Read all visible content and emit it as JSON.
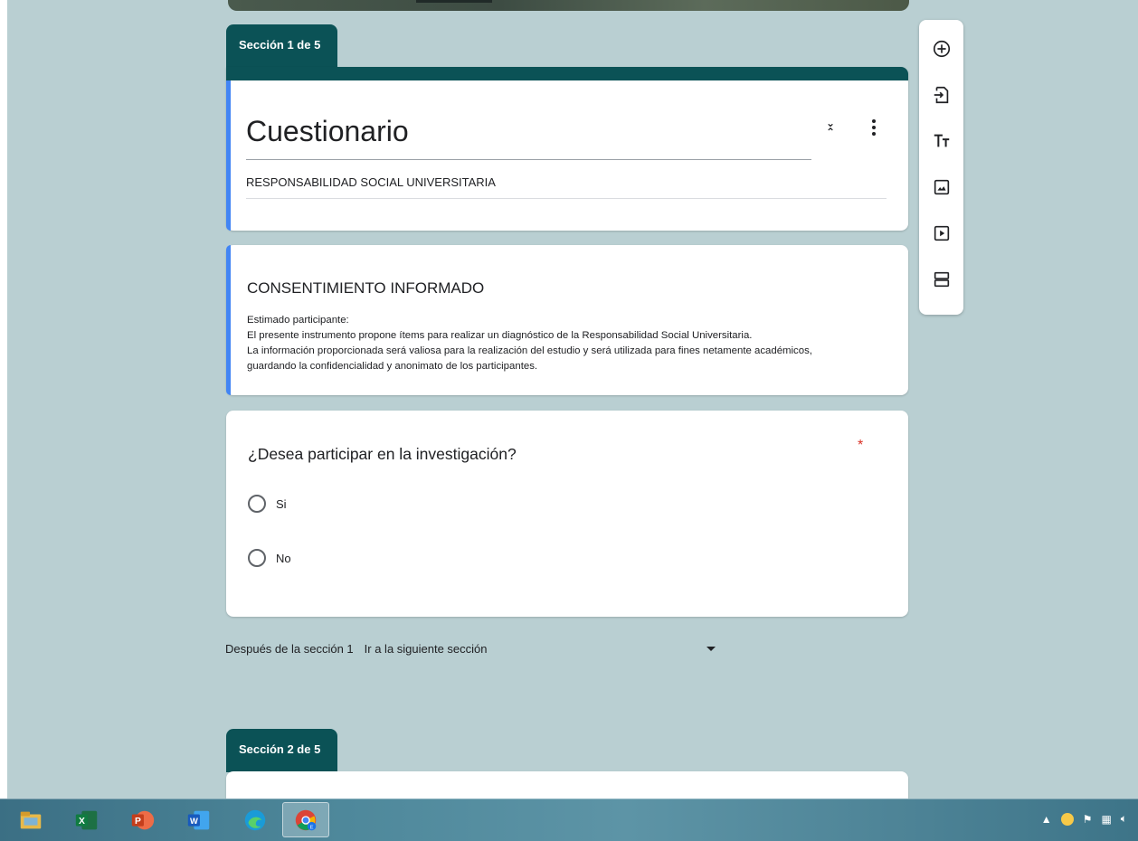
{
  "sections": [
    {
      "tab_label": "Sección 1 de 5"
    },
    {
      "tab_label": "Sección 2 de 5"
    }
  ],
  "form": {
    "title": "Cuestionario",
    "description": "RESPONSABILIDAD SOCIAL UNIVERSITARIA"
  },
  "consent": {
    "title": "CONSENTIMIENTO INFORMADO",
    "lines": [
      "Estimado participante:",
      "El presente instrumento propone ítems para realizar un diagnóstico de la Responsabilidad Social Universitaria.",
      "La información proporcionada será valiosa para la realización del estudio y será utilizada para fines netamente académicos,",
      "guardando la confidencialidad y anonimato de los participantes."
    ]
  },
  "question": {
    "text": "¿Desea participar en la investigación?",
    "required_marker": "*",
    "options": [
      "Si",
      "No"
    ]
  },
  "after_section": {
    "label": "Después de la sección 1",
    "value": "Ir a la siguiente sección"
  },
  "toolbar": {
    "icons": [
      "add-question-icon",
      "import-questions-icon",
      "add-title-icon",
      "add-image-icon",
      "add-video-icon",
      "add-section-icon"
    ]
  },
  "taskbar": {
    "apps": [
      "file-explorer-icon",
      "excel-icon",
      "powerpoint-icon",
      "word-icon",
      "edge-icon",
      "chrome-icon"
    ]
  },
  "colors": {
    "background": "#b9cfd2",
    "section_header": "#0b5256",
    "accent": "#4285f4",
    "required": "#d93025"
  }
}
